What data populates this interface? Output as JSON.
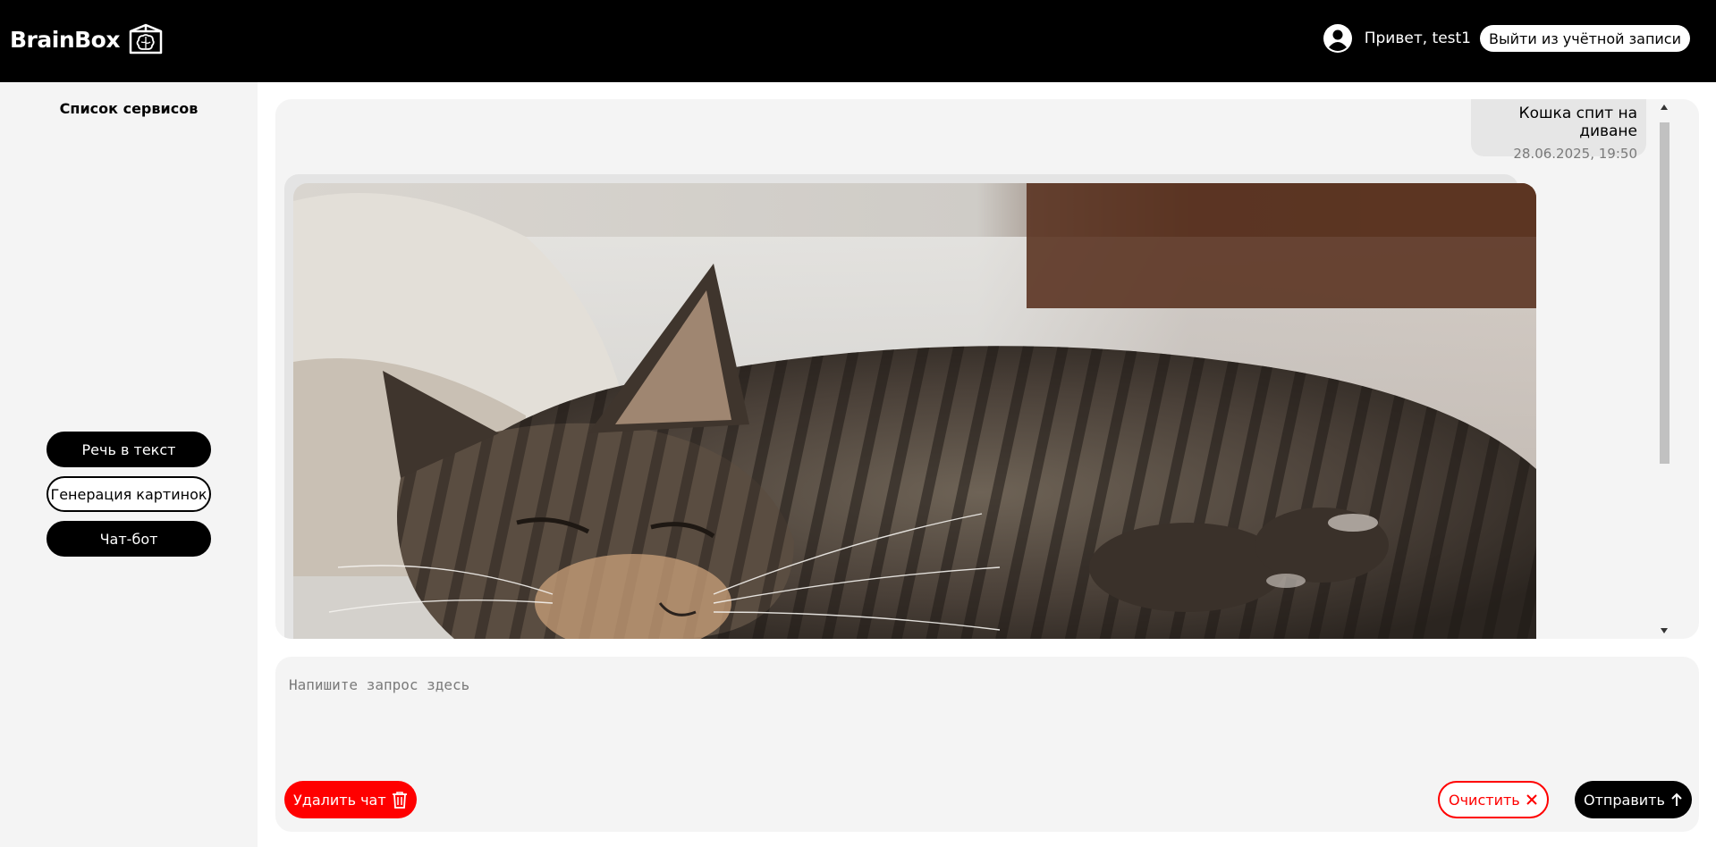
{
  "app": {
    "name": "BrainBox",
    "logo_icon": "brain-box-icon"
  },
  "header": {
    "greeting": "Привет, test1",
    "logout_label": "Выйти из учётной записи",
    "avatar_icon": "user-avatar-icon"
  },
  "sidebar": {
    "title": "Список сервисов",
    "items": [
      {
        "label": "Речь в текст",
        "active": false
      },
      {
        "label": "Генерация картинок",
        "active": true
      },
      {
        "label": "Чат-бот",
        "active": false
      }
    ]
  },
  "chat": {
    "messages": [
      {
        "role": "user",
        "text": "Кошка спит на диване",
        "time": "28.06.2025, 19:50"
      },
      {
        "role": "bot",
        "type": "image",
        "image_desc_icon": "sleeping-tabby-cat-image"
      }
    ]
  },
  "composer": {
    "placeholder": "Напишите запрос здесь",
    "value": "",
    "delete_label": "Удалить чат",
    "clear_label": "Очистить",
    "send_label": "Отправить"
  },
  "colors": {
    "header_bg": "#000000",
    "panel_bg": "#f4f4f4",
    "danger": "#ff0000",
    "primary": "#000000"
  }
}
